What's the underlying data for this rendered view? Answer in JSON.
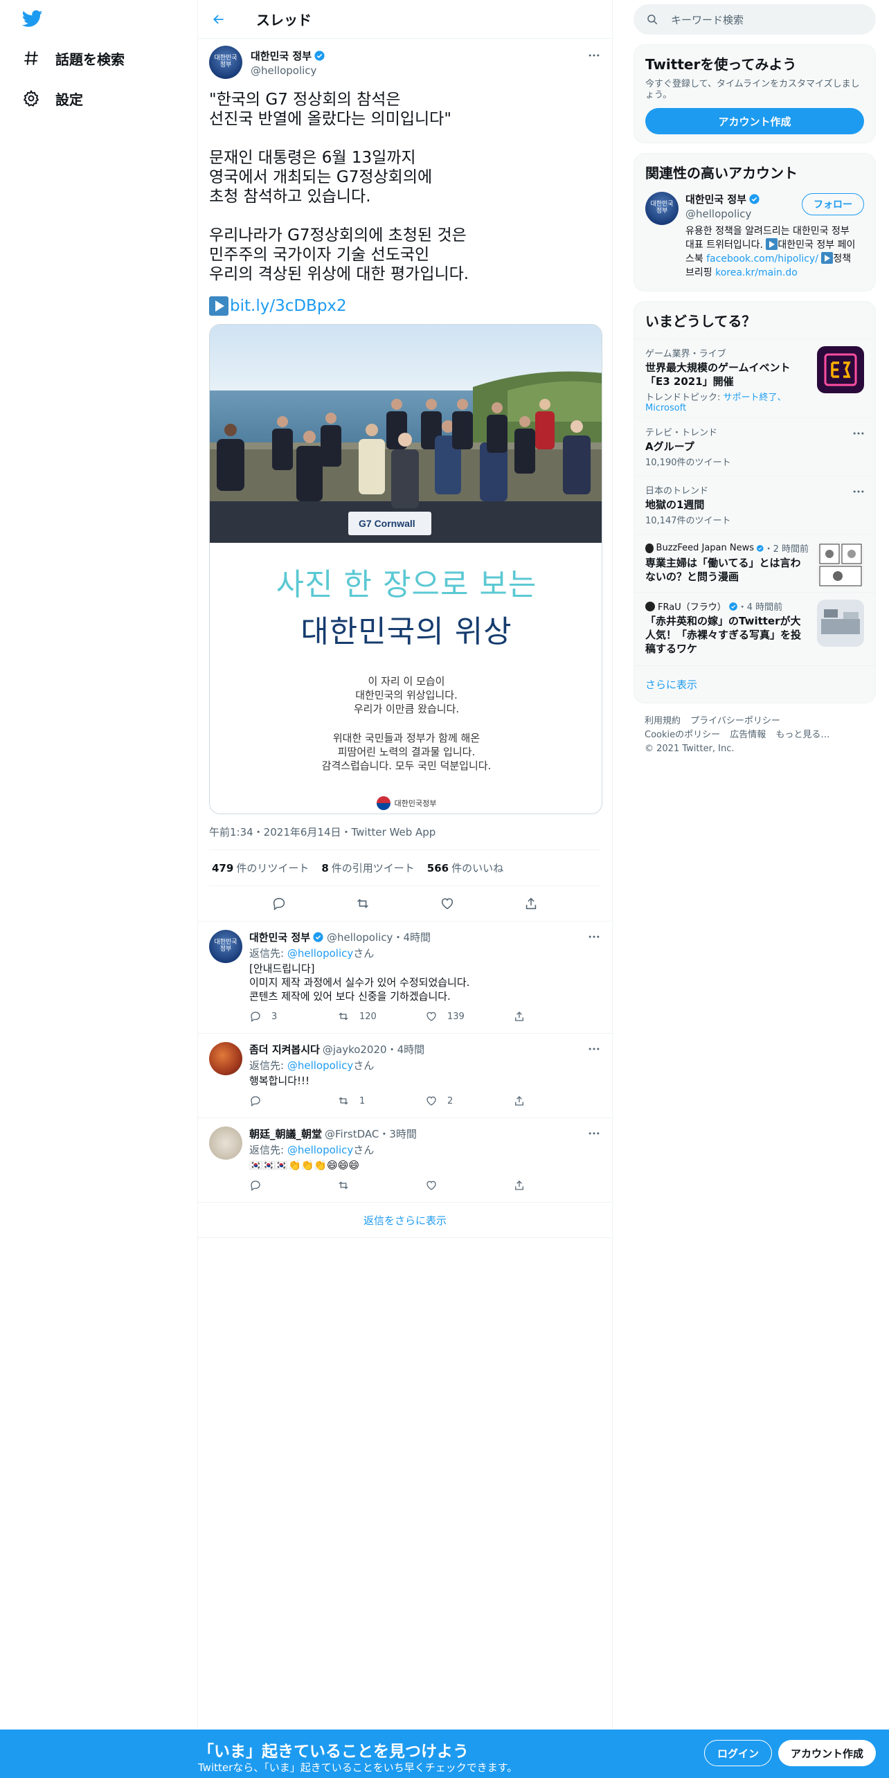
{
  "nav": {
    "items": [
      {
        "label": "話題を検索",
        "icon": "hashtag-icon"
      },
      {
        "label": "設定",
        "icon": "gear-icon"
      }
    ]
  },
  "header": {
    "title": "スレッド"
  },
  "main_tweet": {
    "author_name": "대한민국 정부",
    "author_handle": "@hellopolicy",
    "avatar_text": "대한민국\n정부",
    "text": "\"한국의 G7 정상회의 참석은\n선진국 반열에 올랐다는 의미입니다\"\n\n문재인 대통령은 6월 13일까지\n영국에서 개최되는 G7정상회의에\n초청 참석하고 있습니다.\n\n우리나라가 G7정상회의에 초청된 것은\n민주주의 국가이자 기술 선도국인\n우리의 격상된 위상에 대한 평가입니다.",
    "link": "bit.ly/3cDBpx2",
    "card": {
      "title1": "사진 한 장으로 보는",
      "title2": "대한민국의 위상",
      "para1": "이 자리 이 모습이\n대한민국의 위상입니다.\n우리가 이만큼 왔습니다.",
      "para2": "위대한 국민들과 정부가 함께 해온\n피땀어린 노력의 결과물 입니다.\n감격스럽습니다. 모두 국민 덕분입니다.",
      "seal": "대한민국정부",
      "banner": "G7 Cornwall"
    },
    "timestamp": "午前1:34・2021年6月14日・Twitter Web App",
    "stats": {
      "retweets": "479",
      "retweets_label": "件のリツイート",
      "quotes": "8",
      "quotes_label": "件の引用ツイート",
      "likes": "566",
      "likes_label": "件のいいね"
    }
  },
  "replies": [
    {
      "name": "대한민국 정부",
      "handle": "@hellopolicy",
      "time": "・4時間",
      "reply_to_prefix": "返信先: ",
      "reply_to": "@hellopolicy",
      "reply_to_suffix": "さん",
      "text": "[안내드립니다]\n이미지 제작 과정에서 실수가 있어 수정되었습니다.\n콘텐츠 제작에 있어 보다 신중을 기하겠습니다.",
      "replies": "3",
      "retweets": "120",
      "likes": "139",
      "verified": true
    },
    {
      "name": "좀더 지켜봅시다",
      "handle": "@jayko2020",
      "time": "・4時間",
      "reply_to_prefix": "返信先: ",
      "reply_to": "@hellopolicy",
      "reply_to_suffix": "さん",
      "text": "행복합니다!!!",
      "replies": "",
      "retweets": "1",
      "likes": "2",
      "verified": false
    },
    {
      "name": "朝廷_朝議_朝堂",
      "handle": "@FirstDAC",
      "time": "・3時間",
      "reply_to_prefix": "返信先: ",
      "reply_to": "@hellopolicy",
      "reply_to_suffix": "さん",
      "text": "🇰🇷🇰🇷🇰🇷👏👏👏😄😄😄",
      "replies": "",
      "retweets": "",
      "likes": "",
      "verified": false
    }
  ],
  "show_more_replies": "返信をさらに表示",
  "search": {
    "placeholder": "キーワード検索"
  },
  "signup_panel": {
    "title": "Twitterを使ってみよう",
    "subtitle": "今すぐ登録して、タイムラインをカスタマイズしましょう。",
    "button": "アカウント作成"
  },
  "related_panel": {
    "title": "関連性の高いアカウント",
    "name": "대한민국 정부",
    "handle": "@hellopolicy",
    "follow": "フォロー",
    "bio_1": "유용한 정책을 알려드리는 대한민국 정부 대표 트위터입니다. ",
    "bio_2": "대한민국 정부 페이스북 ",
    "bio_link1": "facebook.com/hipolicy/",
    "bio_3": "정책브리핑 ",
    "bio_link2": "korea.kr/main.do"
  },
  "trends_panel": {
    "title": "いまどうしてる？",
    "items": [
      {
        "meta": "ゲーム業界・ライブ",
        "title": "世界最大規模のゲームイベント「E3 2021」開催",
        "sub_prefix": "トレンドトピック: ",
        "sub_link": "サポート終了、Microsoft"
      },
      {
        "meta": "テレビ・トレンド",
        "title": "Aグループ",
        "sub": "10,190件のツイート"
      },
      {
        "meta": "日本のトレンド",
        "title": "地獄の1週間",
        "sub": "10,147件のツイート"
      },
      {
        "source": "BuzzFeed Japan News",
        "time": "・2 時間前",
        "title": "専業主婦は「働いてる」とは言わないの？と問う漫画"
      },
      {
        "source": "FRaU（フラウ）",
        "time": "・4 時間前",
        "title": "「赤井英和の嫁」のTwitterが大人気！「赤裸々すぎる写真」を投稿するワケ"
      }
    ],
    "see_more": "さらに表示"
  },
  "footer": {
    "links": [
      "利用規約",
      "プライバシーポリシー",
      "Cookieのポリシー",
      "広告情報",
      "もっと見る…"
    ],
    "copyright": "© 2021 Twitter, Inc."
  },
  "bottom_bar": {
    "title": "「いま」起きていることを見つけよう",
    "subtitle": "Twitterなら、「いま」起きていることをいち早くチェックできます。",
    "login": "ログイン",
    "signup": "アカウント作成"
  }
}
